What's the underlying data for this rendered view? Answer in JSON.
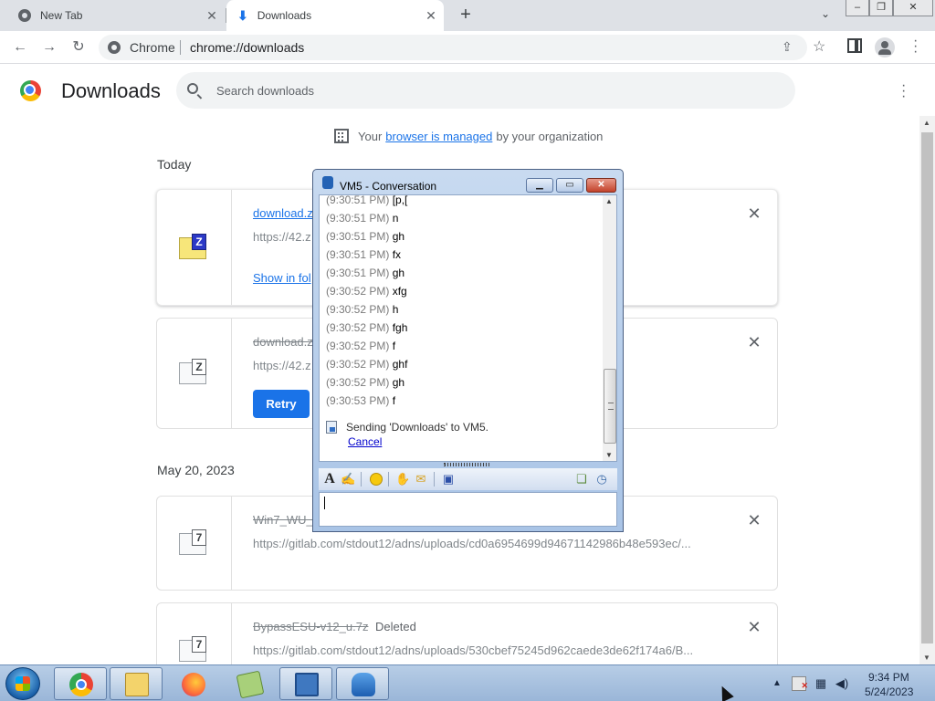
{
  "tabs": [
    {
      "title": "New Tab",
      "icon": "chrome-icon"
    },
    {
      "title": "Downloads",
      "icon": "download-icon"
    }
  ],
  "toolbar": {
    "omnibox_chip": "Chrome",
    "omnibox_url": "chrome://downloads"
  },
  "downloads_page": {
    "title": "Downloads",
    "search_placeholder": "Search downloads",
    "managed": {
      "prefix": "Your",
      "link": "browser is managed",
      "suffix": "by your organization"
    },
    "groups": [
      {
        "date": "Today",
        "items": [
          {
            "name": "download.z",
            "url": "https://42.z",
            "action": "Show in fol",
            "state": "complete"
          },
          {
            "name": "download.z",
            "url": "https://42.z",
            "action": "Retry",
            "state": "failed"
          }
        ]
      },
      {
        "date": "May 20, 2023",
        "items": [
          {
            "name": "Win7_WU_E",
            "url": "https://gitlab.com/stdout12/adns/uploads/cd0a6954699d94671142986b48e593ec/...",
            "state": "deleted"
          },
          {
            "name": "BypassESU-v12_u.7z",
            "status": "Deleted",
            "url": "https://gitlab.com/stdout12/adns/uploads/530cbef75245d962caede3de62f174a6/B...",
            "state": "deleted"
          }
        ]
      }
    ]
  },
  "conversation": {
    "title": "VM5 - Conversation",
    "messages": [
      {
        "time": "(9:30:51 PM)",
        "text": "[p,["
      },
      {
        "time": "(9:30:51 PM)",
        "text": "n"
      },
      {
        "time": "(9:30:51 PM)",
        "text": "gh"
      },
      {
        "time": "(9:30:51 PM)",
        "text": "fx"
      },
      {
        "time": "(9:30:51 PM)",
        "text": "gh"
      },
      {
        "time": "(9:30:52 PM)",
        "text": "xfg"
      },
      {
        "time": "(9:30:52 PM)",
        "text": "h"
      },
      {
        "time": "(9:30:52 PM)",
        "text": "fgh"
      },
      {
        "time": "(9:30:52 PM)",
        "text": "f"
      },
      {
        "time": "(9:30:52 PM)",
        "text": "ghf"
      },
      {
        "time": "(9:30:52 PM)",
        "text": "gh"
      },
      {
        "time": "(9:30:53 PM)",
        "text": "f"
      }
    ],
    "sending_text": "Sending 'Downloads' to VM5.",
    "cancel_label": "Cancel",
    "input_value": ""
  },
  "taskbar": {
    "time": "9:34 PM",
    "date": "5/24/2023"
  },
  "colors": {
    "accent": "#1a73e8",
    "taskbar": "#9ab6d8"
  }
}
